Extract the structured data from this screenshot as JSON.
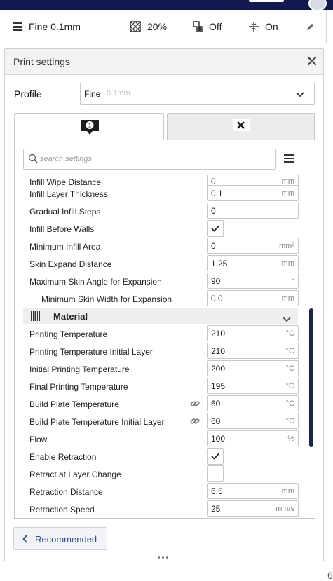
{
  "summary": {
    "profile": "Fine 0.1mm",
    "infill": "20%",
    "support": "Off",
    "adhesion": "On"
  },
  "panel": {
    "title": "Print settings"
  },
  "profile": {
    "label": "Profile",
    "name": "Fine",
    "layer_height": "0.1mm"
  },
  "tabs": {
    "badge": "1"
  },
  "search": {
    "placeholder": "search settings"
  },
  "partial_row": {
    "label": "Infill Wipe Distance",
    "value": "0",
    "unit": "mm"
  },
  "rows": [
    {
      "label": "Infill Layer Thickness",
      "value": "0.1",
      "unit": "mm"
    },
    {
      "label": "Gradual Infill Steps",
      "value": "0",
      "unit": ""
    },
    {
      "label": "Infill Before Walls",
      "checkbox": true,
      "checked": true
    },
    {
      "label": "Minimum Infill Area",
      "value": "0",
      "unit": "mm²"
    },
    {
      "label": "Skin Expand Distance",
      "value": "1.25",
      "unit": "mm"
    },
    {
      "label": "Maximum Skin Angle for Expansion",
      "value": "90",
      "unit": "°"
    },
    {
      "label": "Minimum Skin Width for Expansion",
      "value": "0.0",
      "unit": "mm",
      "indent": true
    }
  ],
  "category": {
    "label": "Material"
  },
  "material_rows": [
    {
      "label": "Printing Temperature",
      "value": "210",
      "unit": "°C"
    },
    {
      "label": "Printing Temperature Initial Layer",
      "value": "210",
      "unit": "°C"
    },
    {
      "label": "Initial Printing Temperature",
      "value": "200",
      "unit": "°C"
    },
    {
      "label": "Final Printing Temperature",
      "value": "195",
      "unit": "°C"
    },
    {
      "label": "Build Plate Temperature",
      "value": "60",
      "unit": "°C",
      "linked": true
    },
    {
      "label": "Build Plate Temperature Initial Layer",
      "value": "60",
      "unit": "°C",
      "linked": true
    },
    {
      "label": "Flow",
      "value": "100",
      "unit": "%"
    },
    {
      "label": "Enable Retraction",
      "checkbox": true,
      "checked": true
    },
    {
      "label": "Retract at Layer Change",
      "checkbox": true,
      "checked": false
    },
    {
      "label": "Retraction Distance",
      "value": "6.5",
      "unit": "mm"
    },
    {
      "label": "Retraction Speed",
      "value": "25",
      "unit": "mm/s"
    }
  ],
  "footer": {
    "recommended_label": "Recommended"
  },
  "edge_glyph": "6",
  "colors": {
    "accent": "#2f4ca3",
    "header_bar": "#111a4e",
    "scrollbar": "#1d2356"
  }
}
